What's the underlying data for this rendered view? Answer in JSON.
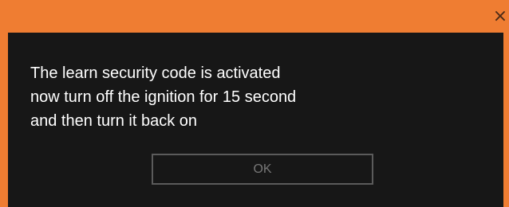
{
  "window": {
    "close_icon": "close-icon",
    "close_glyph": "×"
  },
  "dialog": {
    "message": "The learn security code is activated\nnow turn off the ignition for 15 second\nand then turn it back on",
    "ok_label": "OK"
  },
  "colors": {
    "frame": "#ef7d32",
    "background": "#171717",
    "text": "#ffffff",
    "button_border": "#5b5b5b",
    "button_text": "#777777"
  }
}
